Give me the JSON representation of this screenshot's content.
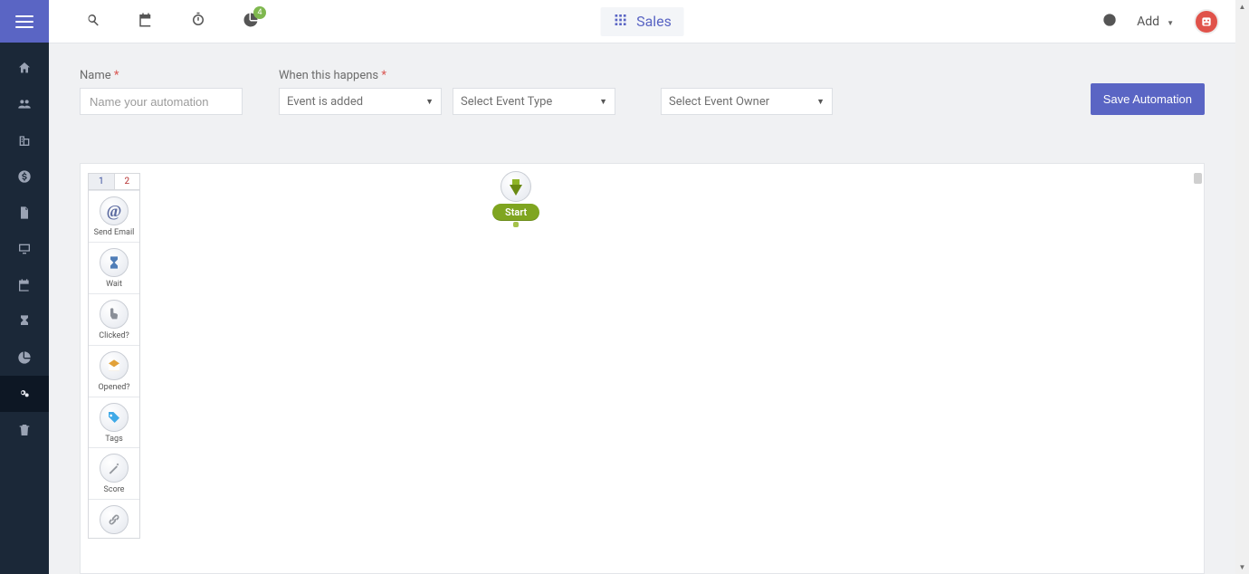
{
  "header": {
    "badge_count": "4",
    "app_label": "Sales",
    "add_label": "Add"
  },
  "sidebar": {
    "items": [
      {
        "name": "home"
      },
      {
        "name": "contacts"
      },
      {
        "name": "companies"
      },
      {
        "name": "deals"
      },
      {
        "name": "documents"
      },
      {
        "name": "web"
      },
      {
        "name": "calendar"
      },
      {
        "name": "hourglass"
      },
      {
        "name": "reports"
      },
      {
        "name": "automation"
      },
      {
        "name": "trash"
      }
    ],
    "active_index": 9
  },
  "form": {
    "name_label": "Name",
    "name_placeholder": "Name your automation",
    "trigger_label": "When this happens",
    "trigger_value": "Event is added",
    "event_type_placeholder": "Select Event Type",
    "event_owner_placeholder": "Select Event Owner",
    "save_label": "Save Automation"
  },
  "canvas": {
    "start_label": "Start",
    "palette_tabs": [
      "1",
      "2"
    ],
    "palette_active_tab": 0,
    "palette": [
      {
        "key": "send_email",
        "label": "Send Email"
      },
      {
        "key": "wait",
        "label": "Wait"
      },
      {
        "key": "clicked",
        "label": "Clicked?"
      },
      {
        "key": "opened",
        "label": "Opened?"
      },
      {
        "key": "tags",
        "label": "Tags"
      },
      {
        "key": "score",
        "label": "Score"
      },
      {
        "key": "link",
        "label": ""
      }
    ]
  }
}
